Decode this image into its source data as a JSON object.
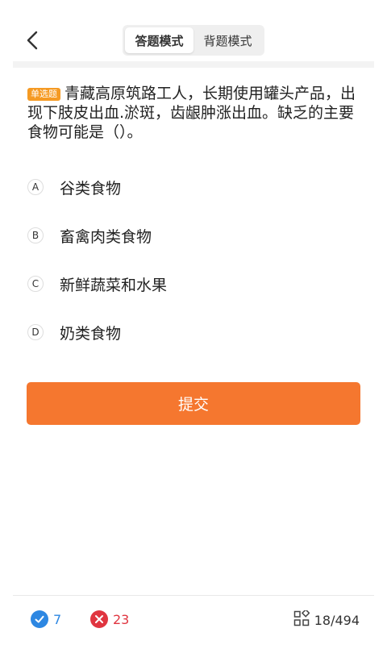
{
  "header": {
    "tabs": [
      {
        "label": "答题模式",
        "active": true
      },
      {
        "label": "背题模式",
        "active": false
      }
    ]
  },
  "question": {
    "type_badge": "单选题",
    "text": "青藏高原筑路工人，长期使用罐头产品，出现下肢皮出血.淤斑，齿龈肿涨出血。缺乏的主要食物可能是（）。"
  },
  "options": [
    {
      "letter": "A",
      "text": "谷类食物"
    },
    {
      "letter": "B",
      "text": "畜禽肉类食物"
    },
    {
      "letter": "C",
      "text": "新鲜蔬菜和水果"
    },
    {
      "letter": "D",
      "text": "奶类食物"
    }
  ],
  "submit_label": "提交",
  "footer": {
    "correct_count": "7",
    "wrong_count": "23",
    "progress": "18/494"
  },
  "colors": {
    "accent_orange": "#f5772f",
    "badge_orange": "#f59a23",
    "correct_blue": "#2d87e2",
    "wrong_red": "#e03540"
  },
  "icons": {
    "back": "chevron-left-icon",
    "correct": "check-circle-icon",
    "wrong": "x-circle-icon",
    "progress": "grid-icon"
  }
}
